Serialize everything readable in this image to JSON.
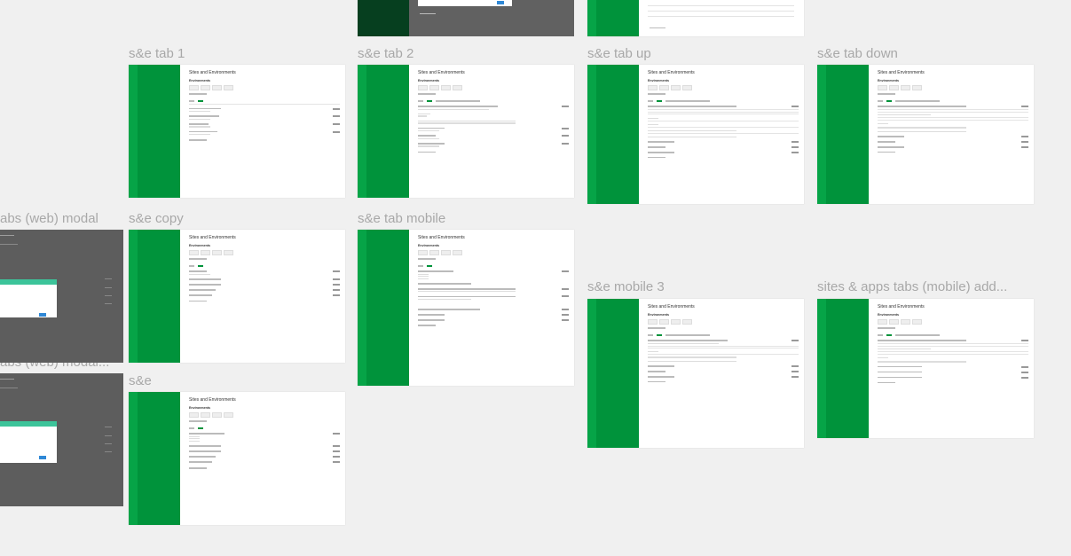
{
  "labels": {
    "tab1": "s&e tab 1",
    "tab2": "s&e tab 2",
    "tab_up": "s&e tab up",
    "tab_down": "s&e tab down",
    "modal1": "abs (web) modal",
    "copy": "s&e copy",
    "mobile": "s&e tab mobile",
    "mobile3": "s&e mobile 3",
    "sites_apps_tabs": "sites & apps tabs (mobile) add...",
    "modal2": "abs (web) modal...",
    "se": "s&e"
  },
  "artboard_content": {
    "title": "Sites and Environments",
    "section": "Environments"
  },
  "colors": {
    "canvas": "#f0f0f0",
    "green_bar": "#00933b",
    "green_bar_light": "#06a447",
    "modal_gray": "#5d5d5d",
    "modal_header": "#3cc49a",
    "label_text": "#a8a8a8"
  }
}
